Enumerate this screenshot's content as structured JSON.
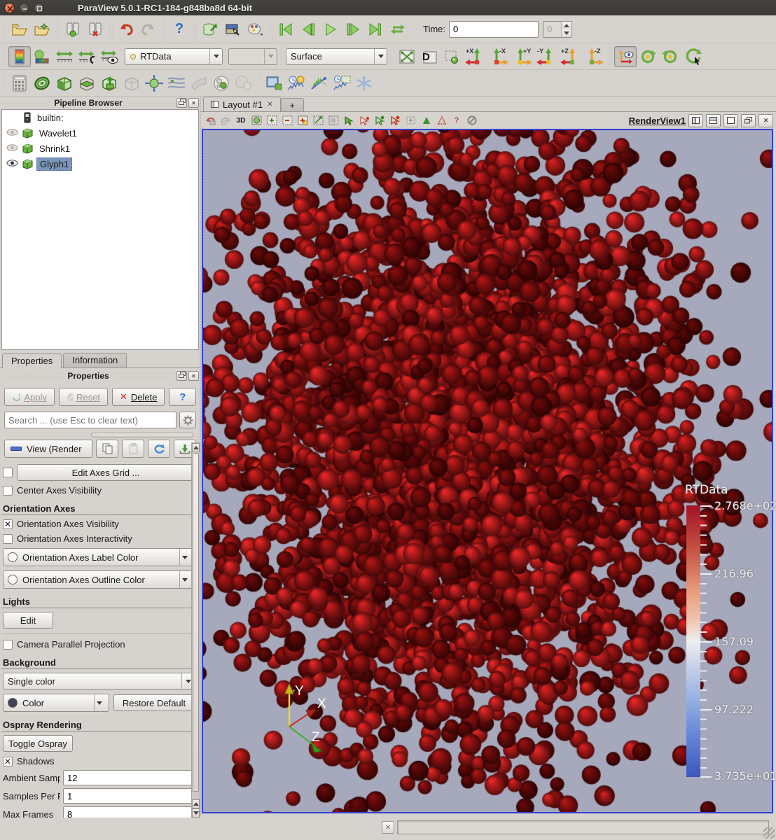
{
  "window": {
    "title": "ParaView 5.0.1-RC1-184-g848ba8d 64-bit"
  },
  "icons": {
    "check": "✕",
    "close": "✕",
    "help": "?",
    "d_label": "D",
    "threed": "3D"
  },
  "toolbar_time": {
    "label": "Time:",
    "value": "0",
    "frame": "0"
  },
  "toolbar_color": {
    "array_name": "RTData",
    "block": "",
    "representation": "Surface"
  },
  "axis_buttons": [
    "+X",
    "-X",
    "+Y",
    "-Y",
    "+Z",
    "-Z"
  ],
  "layout": {
    "tab": "Layout #1",
    "tab_close": "✕",
    "new_tab": "+",
    "view_title": "RenderView1"
  },
  "pipeline": {
    "header": "Pipeline Browser",
    "items": [
      {
        "label": "builtin:"
      },
      {
        "label": "Wavelet1"
      },
      {
        "label": "Shrink1"
      },
      {
        "label": "Glyph1"
      }
    ]
  },
  "panel_tabs": {
    "properties": "Properties",
    "information": "Information"
  },
  "properties": {
    "header": "Properties",
    "apply": "Apply",
    "reset": "Reset",
    "delete": "Delete",
    "search_placeholder": "Search ... (use Esc to clear text)",
    "view_combo": "View (Render",
    "edit_axes_grid": "Edit Axes Grid ...",
    "center_axes": "Center Axes Visibility",
    "orientation_header": "Orientation Axes",
    "orientation_visibility": "Orientation Axes Visibility",
    "orientation_interactivity": "Orientation Axes Interactivity",
    "label_color": "Orientation Axes Label Color",
    "outline_color": "Orientation Axes Outline Color",
    "lights_header": "Lights",
    "lights_edit": "Edit",
    "camera_parallel": "Camera Parallel Projection",
    "background_header": "Background",
    "background_mode": "Single color",
    "color_button": "Color",
    "restore_default": "Restore Default",
    "ospray_header": "Ospray Rendering",
    "toggle_ospray": "Toggle Ospray",
    "shadows": "Shadows",
    "ambient_samples_label": "Ambient Samples",
    "ambient_samples": "12",
    "samples_per_pixel_label": "Samples Per Pixel",
    "samples_per_pixel": "1",
    "max_frames_label": "Max Frames",
    "max_frames": "8"
  },
  "scene": {
    "background": "#a6a9bb",
    "colorbar": {
      "title": "RTData",
      "labels": [
        "2.768e+02",
        "216.96",
        "157.09",
        "97.222",
        "3.735e+01"
      ],
      "colormap_top": "#a31227",
      "colormap_mid": "#efeff1",
      "colormap_bottom": "#3c56c0"
    },
    "triad": {
      "x": "X",
      "y": "Y",
      "z": "Z"
    },
    "spheres": {
      "seed": 12,
      "count": 3600,
      "cx": 0.45,
      "cy": 0.455,
      "sx": 0.205,
      "sy": 0.21,
      "rmin": 10,
      "rmax": 15.5,
      "palette": [
        "#4a0606",
        "#5c0909",
        "#6b0c0c",
        "#7a0f0f",
        "#891313",
        "#951616",
        "#a01a1a"
      ]
    }
  }
}
